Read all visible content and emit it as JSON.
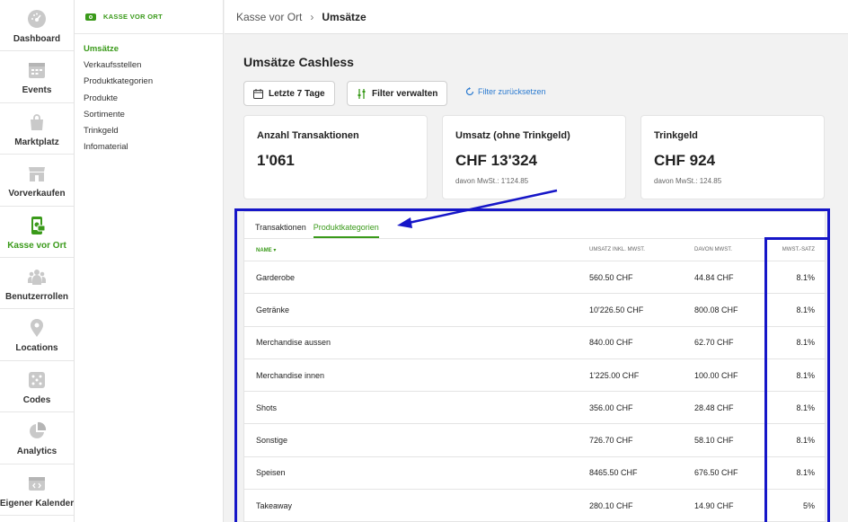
{
  "rail": [
    {
      "label": "Dashboard",
      "icon": "dashboard-gauge-icon"
    },
    {
      "label": "Events",
      "icon": "calendar-icon"
    },
    {
      "label": "Marktplatz",
      "icon": "shopping-bag-icon"
    },
    {
      "label": "Vorverkaufen",
      "icon": "store-icon"
    },
    {
      "label": "Kasse vor Ort",
      "icon": "mobile-ticket-icon",
      "active": true
    },
    {
      "label": "Benutzerrollen",
      "icon": "users-icon"
    },
    {
      "label": "Locations",
      "icon": "map-pin-icon"
    },
    {
      "label": "Codes",
      "icon": "dice-icon"
    },
    {
      "label": "Analytics",
      "icon": "pie-chart-icon"
    },
    {
      "label": "Eigener Kalender",
      "icon": "calendar-embed-icon"
    }
  ],
  "subnav": {
    "heading": "KASSE VOR ORT",
    "items": [
      "Umsätze",
      "Verkaufsstellen",
      "Produktkategorien",
      "Produkte",
      "Sortimente",
      "Trinkgeld",
      "Infomaterial"
    ]
  },
  "breadcrumb": {
    "parent": "Kasse vor Ort",
    "separator": "›",
    "current": "Umsätze"
  },
  "main": {
    "title": "Umsätze Cashless",
    "date_button": "Letzte 7 Tage",
    "filter_button": "Filter verwalten",
    "reset_link": "Filter zurücksetzen"
  },
  "cards": [
    {
      "title": "Anzahl Transaktionen",
      "value": "1'061",
      "sub": ""
    },
    {
      "title": "Umsatz (ohne Trinkgeld)",
      "value": "CHF 13'324",
      "sub": "davon MwSt.: 1'124.85"
    },
    {
      "title": "Trinkgeld",
      "value": "CHF 924",
      "sub": "davon MwSt.: 124.85"
    }
  ],
  "tabs": [
    "Transaktionen",
    "Produktkategorien"
  ],
  "table": {
    "headers": [
      "NAME",
      "UMSATZ INKL. MWST.",
      "DAVON MWST.",
      "MWST.-SATZ"
    ],
    "rows": [
      [
        "Garderobe",
        "560.50 CHF",
        "44.84 CHF",
        "8.1%"
      ],
      [
        "Getränke",
        "10'226.50 CHF",
        "800.08 CHF",
        "8.1%"
      ],
      [
        "Merchandise aussen",
        "840.00 CHF",
        "62.70 CHF",
        "8.1%"
      ],
      [
        "Merchandise innen",
        "1'225.00 CHF",
        "100.00 CHF",
        "8.1%"
      ],
      [
        "Shots",
        "356.00 CHF",
        "28.48 CHF",
        "8.1%"
      ],
      [
        "Sonstige",
        "726.70 CHF",
        "58.10 CHF",
        "8.1%"
      ],
      [
        "Speisen",
        "8465.50 CHF",
        "676.50 CHF",
        "8.1%"
      ],
      [
        "Takeaway",
        "280.10 CHF",
        "14.90 CHF",
        "5%"
      ]
    ]
  },
  "colors": {
    "accent": "#3a9a1a",
    "link": "#2a7ad0",
    "annotation": "#1616c8"
  }
}
